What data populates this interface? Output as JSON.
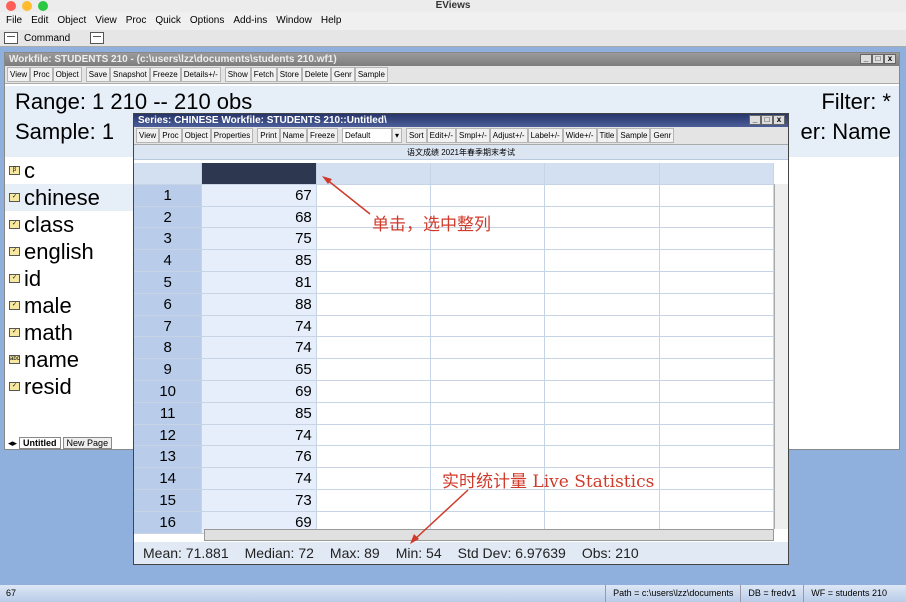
{
  "app_title": "EViews",
  "menu": [
    "File",
    "Edit",
    "Object",
    "View",
    "Proc",
    "Quick",
    "Options",
    "Add-ins",
    "Window",
    "Help"
  ],
  "command_label": "Command",
  "workfile": {
    "title": "Workfile: STUDENTS 210 - (c:\\users\\lzz\\documents\\students 210.wf1)",
    "toolbar": [
      "View",
      "Proc",
      "Object",
      "|",
      "Save",
      "Snapshot",
      "Freeze",
      "Details+/-",
      "|",
      "Show",
      "Fetch",
      "Store",
      "Delete",
      "Genr",
      "Sample"
    ],
    "range": "Range:  1 210   --   210 obs",
    "sample": "Sample: 1",
    "filter": "Filter: *",
    "order": "er: Name",
    "objects": [
      {
        "name": "c",
        "icon": "coef-icon"
      },
      {
        "name": "chinese",
        "icon": "series-icon"
      },
      {
        "name": "class",
        "icon": "series-icon"
      },
      {
        "name": "english",
        "icon": "series-icon"
      },
      {
        "name": "id",
        "icon": "series-icon"
      },
      {
        "name": "male",
        "icon": "series-icon"
      },
      {
        "name": "math",
        "icon": "series-icon"
      },
      {
        "name": "name",
        "icon": "alpha-icon"
      },
      {
        "name": "resid",
        "icon": "series-icon"
      }
    ],
    "tabs": [
      "Untitled",
      "New Page"
    ]
  },
  "series": {
    "title": "Series: CHINESE   Workfile: STUDENTS 210::Untitled\\",
    "toolbar": [
      "View",
      "Proc",
      "Object",
      "Properties",
      "|",
      "Print",
      "Name",
      "Freeze"
    ],
    "dropdown": "Default",
    "toolbar2": [
      "Sort",
      "Edit+/-",
      "Smpl+/-",
      "Adjust+/-",
      "Label+/-",
      "Wide+/-",
      "Title",
      "Sample",
      "Genr"
    ],
    "label": "语文成绩 2021年春季期末考试",
    "rows": [
      [
        "1",
        "67"
      ],
      [
        "2",
        "68"
      ],
      [
        "3",
        "75"
      ],
      [
        "4",
        "85"
      ],
      [
        "5",
        "81"
      ],
      [
        "6",
        "88"
      ],
      [
        "7",
        "74"
      ],
      [
        "8",
        "74"
      ],
      [
        "9",
        "65"
      ],
      [
        "10",
        "69"
      ],
      [
        "11",
        "85"
      ],
      [
        "12",
        "74"
      ],
      [
        "13",
        "76"
      ],
      [
        "14",
        "74"
      ],
      [
        "15",
        "73"
      ],
      [
        "16",
        "69"
      ]
    ],
    "stats": [
      "Mean: 71.881",
      "Median: 72",
      "Max: 89",
      "Min: 54",
      "Std Dev: 6.97639",
      "Obs: 210"
    ]
  },
  "annotations": {
    "click": "单击，选中整列",
    "live": "实时统计量 Live Statistics"
  },
  "status": {
    "left": "67",
    "path": "Path = c:\\users\\lzz\\documents",
    "db": "DB = fredv1",
    "wf": "WF = students 210"
  }
}
